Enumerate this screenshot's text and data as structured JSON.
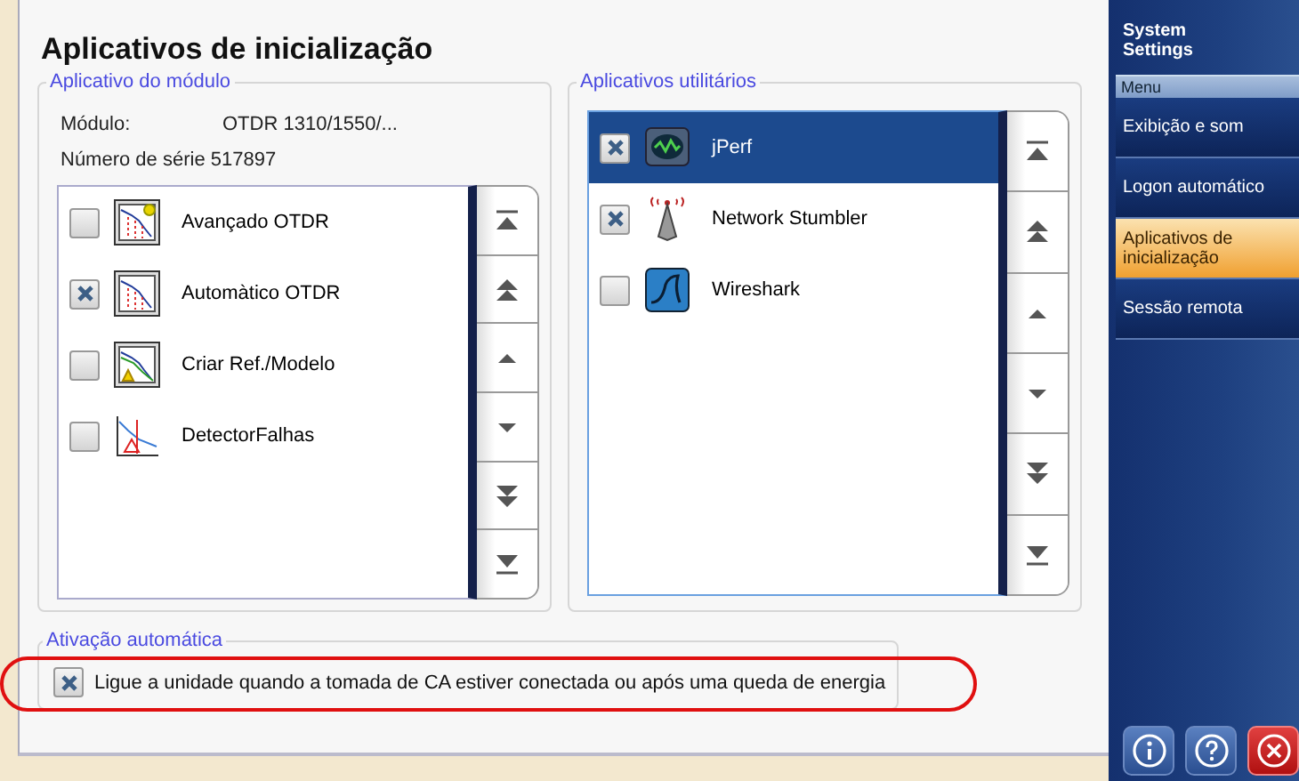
{
  "title": "Aplicativos de inicialização",
  "module_group": {
    "legend": "Aplicativo do módulo",
    "module_label": "Módulo:",
    "module_value": "OTDR 1310/1550/...",
    "serial": "Número de série 517897",
    "apps": [
      {
        "label": "Avançado OTDR",
        "kind": "advanced",
        "checked": false,
        "selected": false
      },
      {
        "label": "Automàtico OTDR",
        "kind": "auto",
        "checked": true,
        "selected": false
      },
      {
        "label": "Criar Ref./Modelo",
        "kind": "reference",
        "checked": false,
        "selected": false
      },
      {
        "label": "DetectorFalhas",
        "kind": "fault",
        "checked": false,
        "selected": false
      }
    ]
  },
  "utility_group": {
    "legend": "Aplicativos utilitários",
    "apps": [
      {
        "label": "jPerf",
        "kind": "meter",
        "checked": true,
        "selected": true
      },
      {
        "label": "Network Stumbler",
        "kind": "antenna",
        "checked": true,
        "selected": false
      },
      {
        "label": "Wireshark",
        "kind": "fin",
        "checked": false,
        "selected": false
      }
    ]
  },
  "auto_start": {
    "legend": "Ativação automática",
    "label": "Ligue a unidade quando a tomada de CA estiver conectada ou após uma queda de energia",
    "checked": true,
    "circled": true
  },
  "sidebar": {
    "title": "System Settings",
    "menu_header": "Menu",
    "items": [
      {
        "label": "Exibição e som",
        "selected": false
      },
      {
        "label": "Logon automático",
        "selected": false
      },
      {
        "label": "Aplicativos de inicialização",
        "selected": true
      },
      {
        "label": "Sessão remota",
        "selected": false
      }
    ]
  }
}
